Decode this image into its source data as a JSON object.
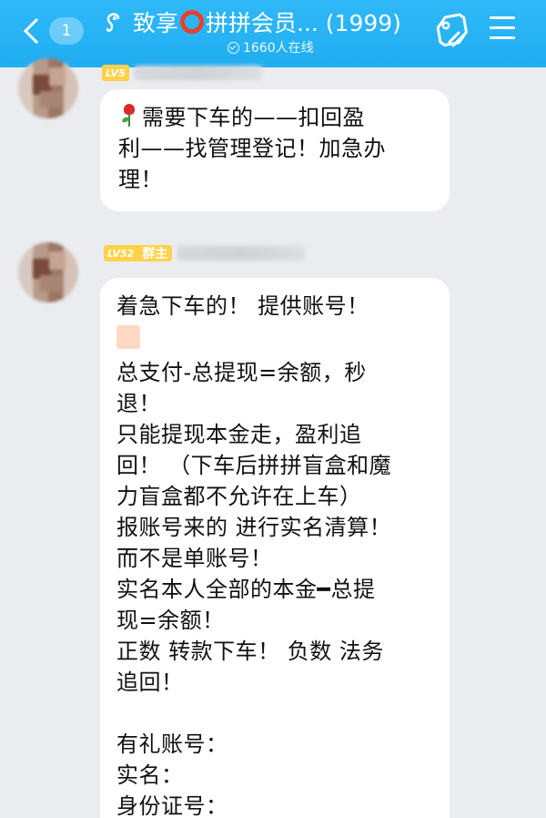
{
  "header": {
    "back_count": "1",
    "title_prefix": "致享",
    "title_ring_icon": "red-circle-icon",
    "title_suffix": "拼拼会员... (1999)",
    "online_text": "1660人在线",
    "ear_icon": "ear-icon",
    "tag_icon": "tag-icon",
    "menu_icon": "menu-icon"
  },
  "messages": [
    {
      "sender_level": "LV5",
      "lines": [
        "需要下车的——扣回盈",
        "利——找管理登记！加急办",
        "理！"
      ],
      "leading_icon": "rose-icon"
    },
    {
      "sender_level": "LV52",
      "sender_role": "群主",
      "lines": [
        "着急下车的！ 提供账号！",
        "总支付-总提现=余额，秒",
        "退！",
        "只能提现本金走，盈利追",
        "回！ （下车后拼拼盲盒和魔",
        "力盲盒都不允许在上车）",
        "报账号来的 进行实名清算！",
        "而不是单账号！",
        "实名本人全部的本金━总提",
        "现=余额！",
        "正数 转款下车！ 负数 法务",
        "追回！",
        "有礼账号：",
        "实名：",
        "身份证号："
      ]
    }
  ],
  "colors": {
    "header_bg": "#20aef2",
    "badge_bg": "#ffd24a",
    "chat_bg": "#eaecef",
    "ring": "#e8402f"
  }
}
